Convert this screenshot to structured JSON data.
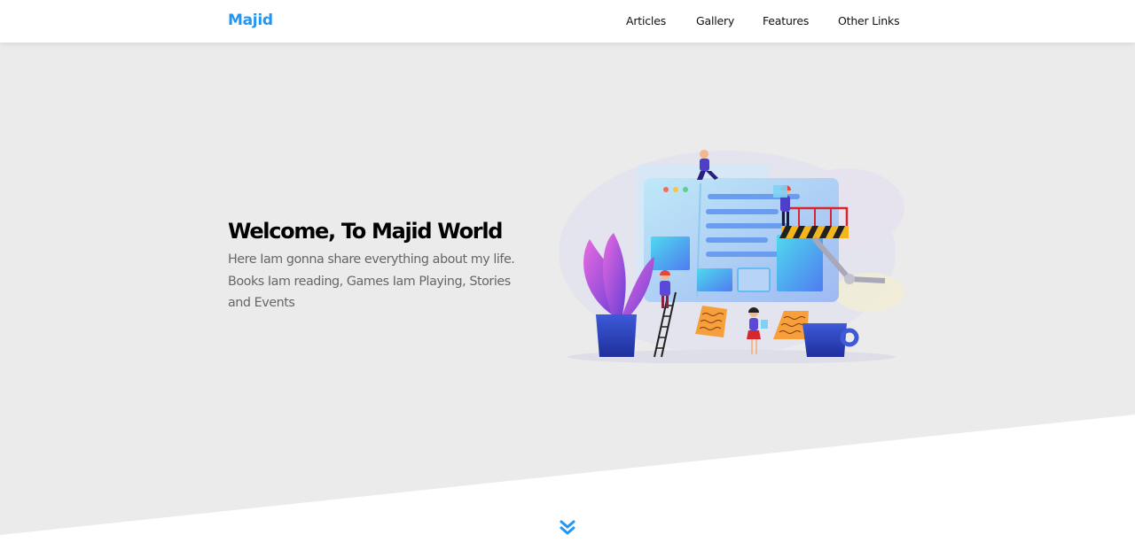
{
  "brand": {
    "name": "Majid",
    "color": "#2196f3"
  },
  "nav": {
    "items": [
      {
        "label": "Articles"
      },
      {
        "label": "Gallery"
      },
      {
        "label": "Features"
      },
      {
        "label": "Other Links"
      }
    ]
  },
  "hero": {
    "title": "Welcome, To Majid World",
    "description": "Here Iam gonna share everything about my life. Books Iam reading, Games Iam Playing, Stories and Events",
    "background": "#ebebeb",
    "illustration_icon": "web-development-illustration"
  },
  "scroll_down": {
    "icon": "chevron-double-down-icon",
    "color": "#2196f3"
  }
}
